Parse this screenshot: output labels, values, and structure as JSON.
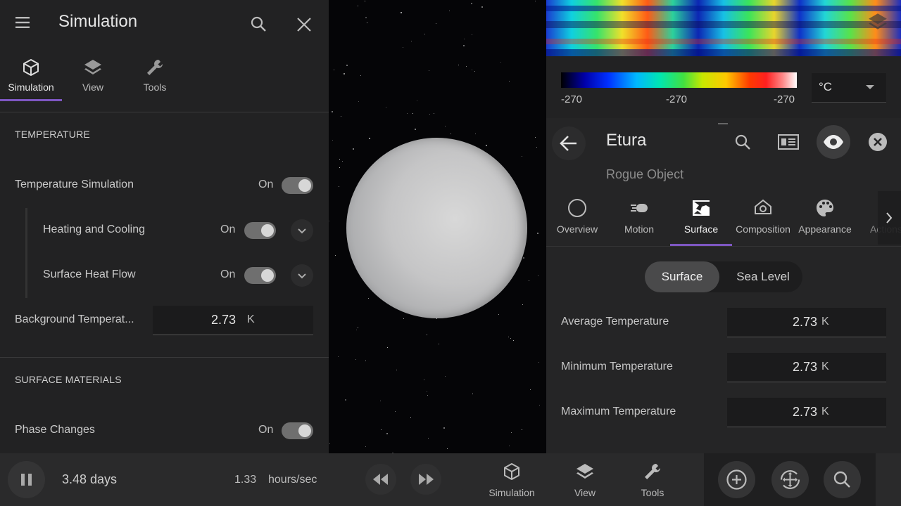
{
  "left_panel": {
    "title": "Simulation",
    "tabs": [
      {
        "label": "Simulation",
        "icon": "cube-icon",
        "active": true
      },
      {
        "label": "View",
        "icon": "layers-icon",
        "active": false
      },
      {
        "label": "Tools",
        "icon": "wrench-icon",
        "active": false
      }
    ],
    "temperature": {
      "heading": "TEMPERATURE",
      "temperature_simulation": {
        "label": "Temperature Simulation",
        "state": "On"
      },
      "heating_cooling": {
        "label": "Heating and Cooling",
        "state": "On"
      },
      "surface_heat_flow": {
        "label": "Surface Heat Flow",
        "state": "On"
      },
      "background_temperature": {
        "label": "Background Temperat...",
        "value": "2.73",
        "unit": "K"
      }
    },
    "surface_materials": {
      "heading": "SURFACE MATERIALS",
      "phase_changes": {
        "label": "Phase Changes",
        "state": "On"
      }
    }
  },
  "temperature_map": {
    "scale_labels": [
      "-270",
      "-270",
      "-270"
    ],
    "unit_select": "°C"
  },
  "object_panel": {
    "name": "Etura",
    "type": "Rogue Object",
    "tabs": [
      {
        "label": "Overview",
        "icon": "circle-icon"
      },
      {
        "label": "Motion",
        "icon": "motion-icon"
      },
      {
        "label": "Surface",
        "icon": "surface-map-icon",
        "active": true
      },
      {
        "label": "Composition",
        "icon": "flask-icon"
      },
      {
        "label": "Appearance",
        "icon": "palette-icon"
      },
      {
        "label": "Actions",
        "icon": "actions-icon"
      }
    ],
    "segment": {
      "surface": "Surface",
      "sea_level": "Sea Level",
      "selected": "Surface"
    },
    "average": {
      "label": "Average Temperature",
      "value": "2.73",
      "unit": "K"
    },
    "minimum": {
      "label": "Minimum Temperature",
      "value": "2.73",
      "unit": "K"
    },
    "maximum": {
      "label": "Maximum Temperature",
      "value": "2.73",
      "unit": "K"
    }
  },
  "bottom_bar": {
    "elapsed": "3.48 days",
    "rate_value": "1.33",
    "rate_unit": "hours/sec",
    "nav": [
      {
        "label": "Simulation",
        "icon": "cube-icon"
      },
      {
        "label": "View",
        "icon": "layers-icon"
      },
      {
        "label": "Tools",
        "icon": "wrench-icon"
      }
    ]
  },
  "colors": {
    "accent": "#7e57c2",
    "panel_bg": "#222223",
    "toggle_track": "#6f6f6f"
  }
}
